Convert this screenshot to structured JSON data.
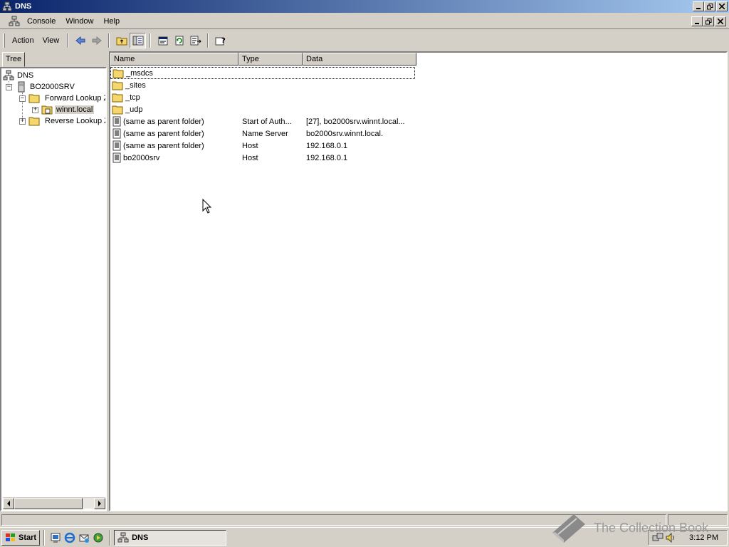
{
  "window": {
    "title": "DNS"
  },
  "menu": {
    "console": "Console",
    "window": "Window",
    "help": "Help"
  },
  "toolbar": {
    "action": "Action",
    "view": "View"
  },
  "tree": {
    "tab": "Tree",
    "root": "DNS",
    "server": "BO2000SRV",
    "forward": "Forward Lookup Z",
    "zone": "winnt.local",
    "reverse": "Reverse Lookup Z"
  },
  "list": {
    "headers": {
      "name": "Name",
      "type": "Type",
      "data": "Data"
    },
    "rows": [
      {
        "name": "_msdcs",
        "type": "",
        "data": "",
        "kind": "folder"
      },
      {
        "name": "_sites",
        "type": "",
        "data": "",
        "kind": "folder"
      },
      {
        "name": "_tcp",
        "type": "",
        "data": "",
        "kind": "folder"
      },
      {
        "name": "_udp",
        "type": "",
        "data": "",
        "kind": "folder"
      },
      {
        "name": "(same as parent folder)",
        "type": "Start of Auth...",
        "data": "[27], bo2000srv.winnt.local...",
        "kind": "record"
      },
      {
        "name": "(same as parent folder)",
        "type": "Name Server",
        "data": "bo2000srv.winnt.local.",
        "kind": "record"
      },
      {
        "name": "(same as parent folder)",
        "type": "Host",
        "data": "192.168.0.1",
        "kind": "record"
      },
      {
        "name": "bo2000srv",
        "type": "Host",
        "data": "192.168.0.1",
        "kind": "record"
      }
    ]
  },
  "taskbar": {
    "start": "Start",
    "task": "DNS",
    "clock": "3:12 PM"
  },
  "watermark": "The Collection Book",
  "colors": {
    "titlebar_start": "#0a246a",
    "titlebar_end": "#a6caf0",
    "face": "#d4d0c8",
    "folder": "#f5d76e"
  }
}
